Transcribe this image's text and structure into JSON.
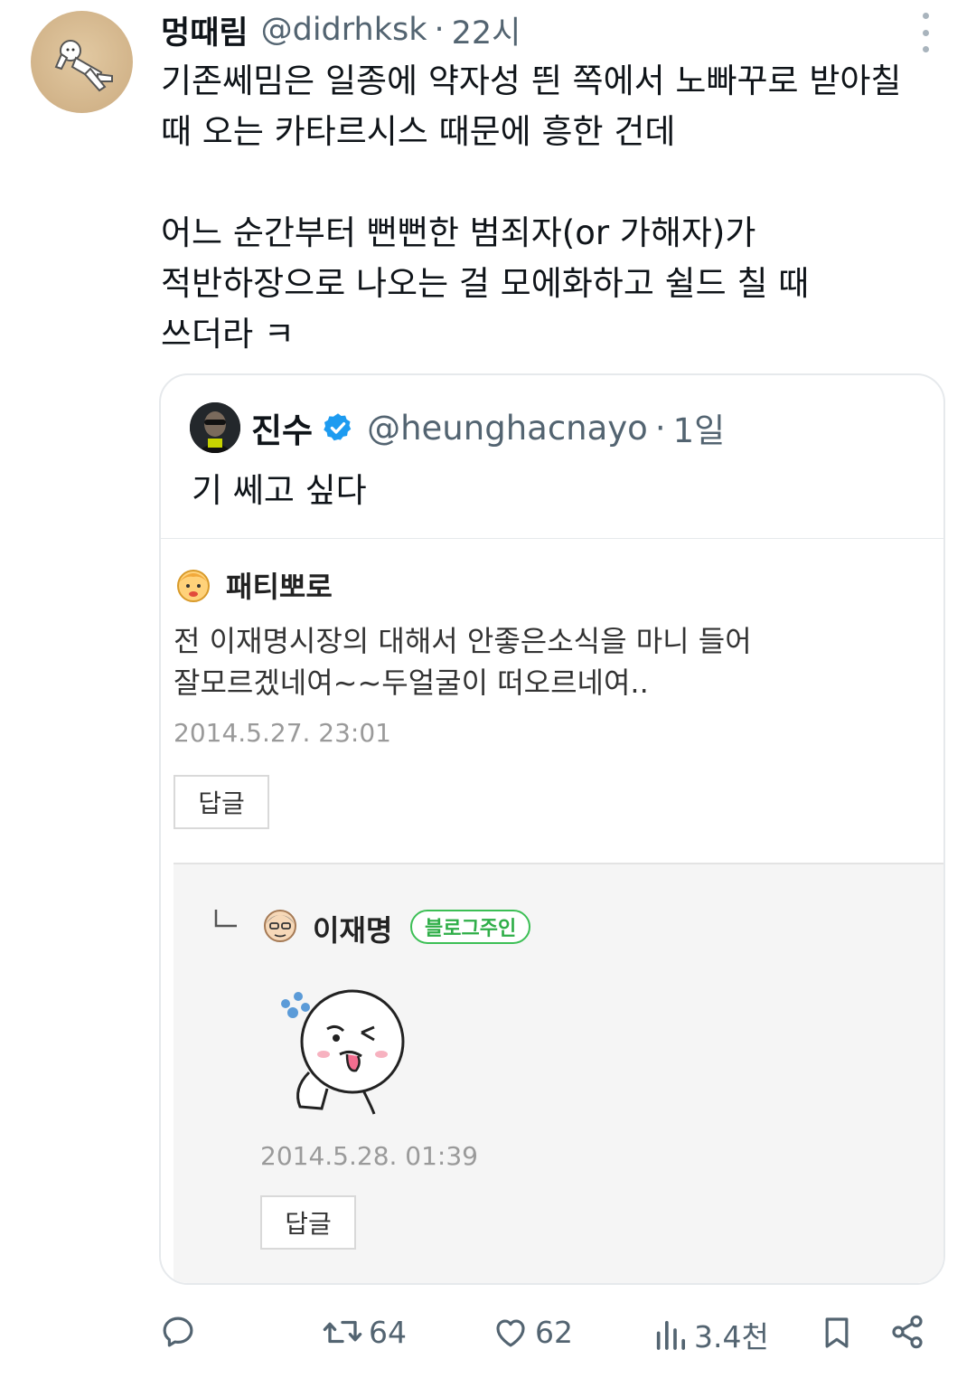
{
  "post": {
    "display_name": "멍때림",
    "handle": "@didrhksk",
    "separator": "·",
    "time": "22시",
    "body_lines": [
      "기존쎄밈은 일종에 약자성 띈 쪽에서 노빠꾸로 받아칠",
      "때 오는 카타르시스 때문에 흥한 건데",
      "",
      "어느 순간부터 뻔뻔한 범죄자(or 가해자)가",
      "적반하장으로 나오는 걸 모에화하고 쉴드 칠 때",
      "쓰더라 ㅋ"
    ]
  },
  "quote": {
    "display_name": "진수",
    "verified": true,
    "handle": "@heunghacnayo",
    "separator": "·",
    "time": "1일",
    "text": "기 쎄고 싶다",
    "embedded_image": {
      "comment": {
        "author": "패티뽀로",
        "text_lines": [
          "전 이재명시장의 대해서 안좋은소식을 마니 들어",
          "잘모르겠네여~~두얼굴이 떠오르네여.."
        ],
        "date": "2014.5.27. 23:01",
        "reply_label": "답글"
      },
      "reply": {
        "author": "이재명",
        "badge": "블로그주인",
        "sticker": "winking-face-sticker",
        "date": "2014.5.28. 01:39",
        "reply_label": "답글"
      }
    }
  },
  "actions": {
    "reply_count": "",
    "retweet_count": "64",
    "like_count": "62",
    "views_count": "3.4천"
  },
  "icons": [
    "more-icon",
    "verified-badge-icon",
    "reply-icon",
    "retweet-icon",
    "like-icon",
    "views-icon",
    "bookmark-icon",
    "share-icon"
  ],
  "colors": {
    "text": "#0f1419",
    "secondary": "#536471",
    "verified": "#1d9bf0",
    "border": "#e6e9ec",
    "badge_green": "#3cbf55"
  }
}
